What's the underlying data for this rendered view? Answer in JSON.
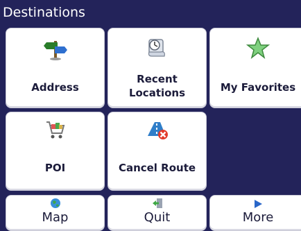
{
  "header": {
    "title": "Destinations"
  },
  "tiles": [
    {
      "label": "Address",
      "icon": "signpost-icon"
    },
    {
      "label_line1": "Recent",
      "label_line2": "Locations",
      "icon": "scroll-icon"
    },
    {
      "label": "My Favorites",
      "icon": "star-icon"
    },
    {
      "label": "POI",
      "icon": "shopping-cart-icon"
    },
    {
      "label": "Cancel Route",
      "icon": "cancel-route-icon"
    }
  ],
  "bottom_bar": [
    {
      "label": "Map",
      "icon": "globe-icon"
    },
    {
      "label": "Quit",
      "icon": "exit-door-icon"
    },
    {
      "label": "More",
      "icon": "arrow-right-icon"
    }
  ],
  "colors": {
    "background": "#23235a",
    "tile": "#ffffff",
    "text": "#1b1b3a"
  }
}
